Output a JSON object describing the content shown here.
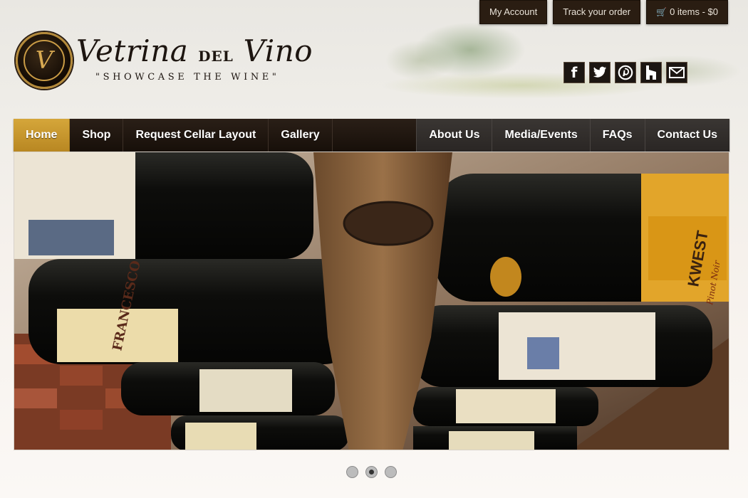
{
  "topbar": {
    "my_account": "My Account",
    "track_order": "Track your order",
    "cart": "0 items - $0"
  },
  "logo": {
    "monogram": "V",
    "name_part1": "Vetrina ",
    "name_del": "DEL",
    "name_part2": " Vino",
    "tagline": "\"SHOWCASE THE WINE\""
  },
  "social": [
    {
      "icon": "facebook-icon",
      "glyph": "f"
    },
    {
      "icon": "twitter-icon",
      "glyph": "t"
    },
    {
      "icon": "pinterest-icon",
      "glyph": "P"
    },
    {
      "icon": "houzz-icon",
      "glyph": "h"
    },
    {
      "icon": "email-icon",
      "glyph": "✉"
    }
  ],
  "nav": {
    "left": [
      "Home",
      "Shop",
      "Request Cellar Layout",
      "Gallery"
    ],
    "right": [
      "About Us",
      "Media/Events",
      "FAQs",
      "Contact Us"
    ],
    "active": "Home"
  },
  "hero": {
    "label_texts": [
      "FRANCESCO",
      "KWEST",
      "Pinot Noir"
    ]
  },
  "slider": {
    "count": 3,
    "active_index": 1
  },
  "colors": {
    "nav_bg": "#1e140c",
    "nav_active": "#c99a30",
    "topbar_bg": "#2a1d12"
  }
}
